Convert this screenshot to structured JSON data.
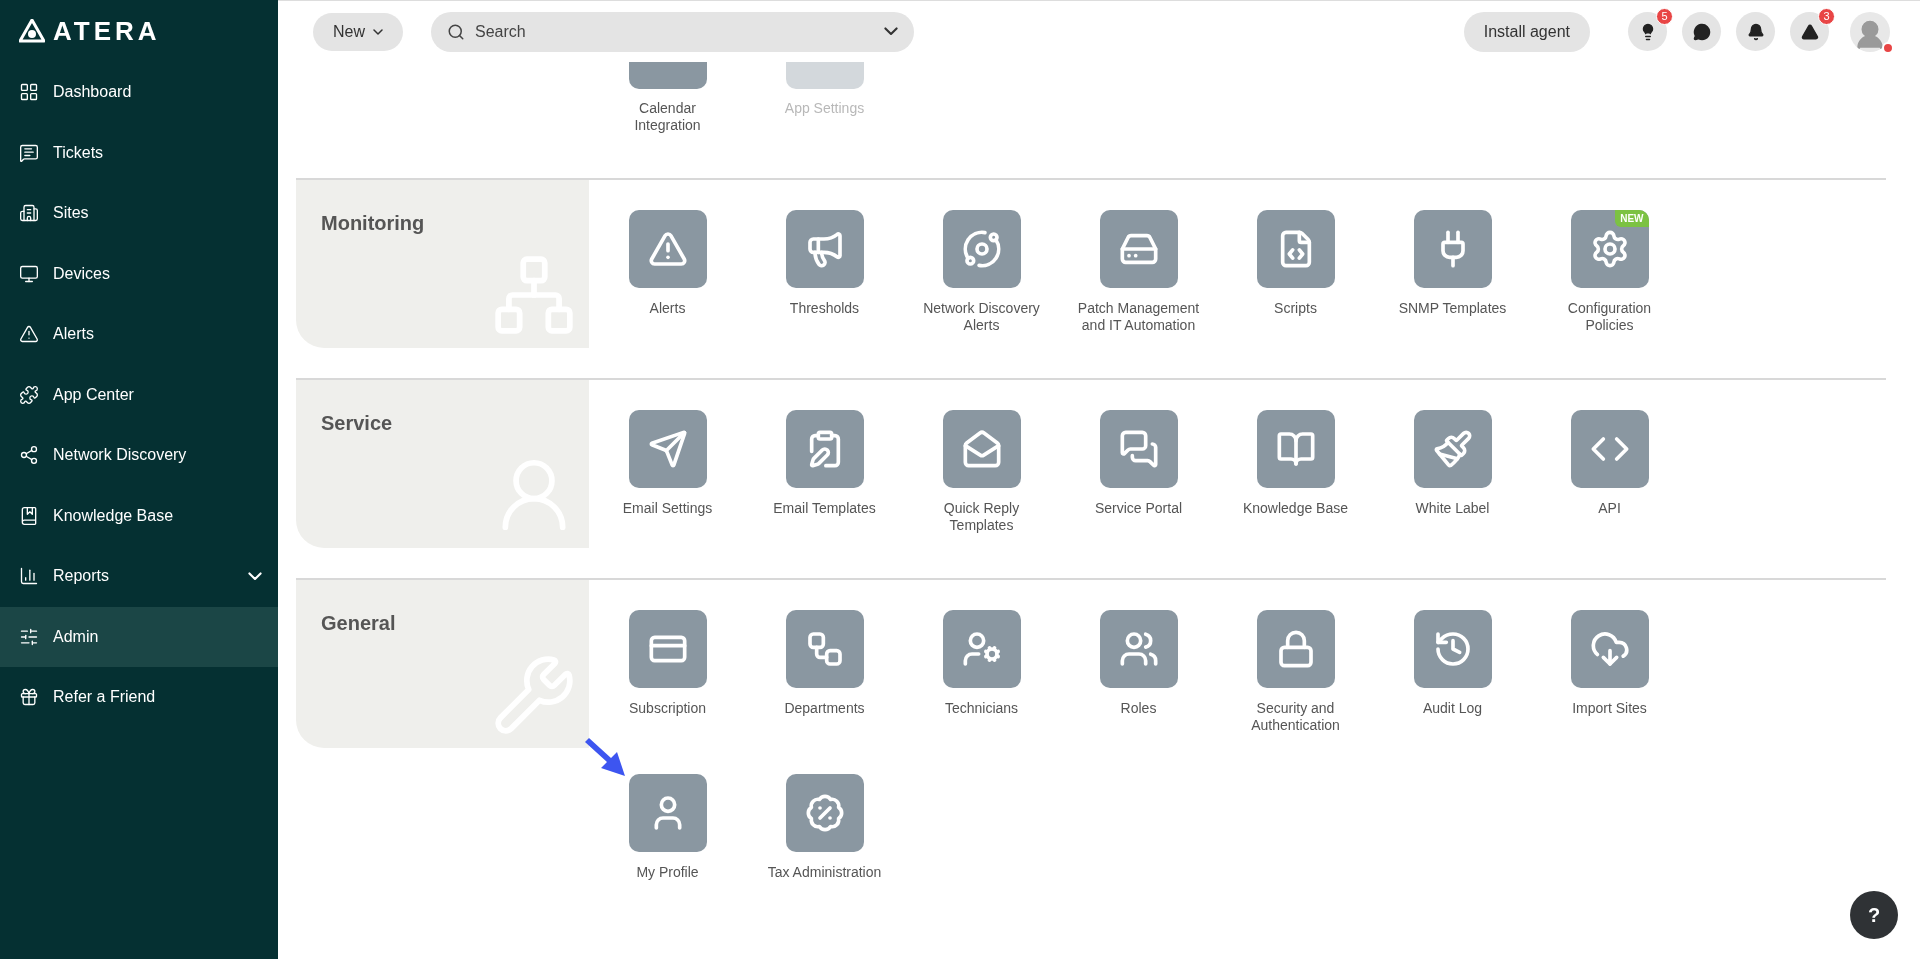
{
  "brand": "ATERA",
  "sidebar": {
    "items": [
      {
        "label": "Dashboard",
        "selected": false,
        "submenu": false
      },
      {
        "label": "Tickets",
        "selected": false,
        "submenu": false
      },
      {
        "label": "Sites",
        "selected": false,
        "submenu": false
      },
      {
        "label": "Devices",
        "selected": false,
        "submenu": false
      },
      {
        "label": "Alerts",
        "selected": false,
        "submenu": false
      },
      {
        "label": "App Center",
        "selected": false,
        "submenu": false
      },
      {
        "label": "Network Discovery",
        "selected": false,
        "submenu": false
      },
      {
        "label": "Knowledge Base",
        "selected": false,
        "submenu": false
      },
      {
        "label": "Reports",
        "selected": false,
        "submenu": true
      },
      {
        "label": "Admin",
        "selected": true,
        "submenu": false
      },
      {
        "label": "Refer a Friend",
        "selected": false,
        "submenu": false
      }
    ]
  },
  "header": {
    "new_button": "New",
    "search": {
      "placeholder": "Search"
    },
    "install_button": "Install agent",
    "hint_badge": "5",
    "alert_badge": "3"
  },
  "top_items": [
    {
      "label": "Calendar Integration",
      "disabled": false
    },
    {
      "label": "App Settings",
      "disabled": true
    }
  ],
  "sections": [
    {
      "title": "Monitoring",
      "items": [
        {
          "label": "Alerts",
          "disabled": false
        },
        {
          "label": "Thresholds",
          "disabled": false
        },
        {
          "label": "Network Discovery Alerts",
          "disabled": false
        },
        {
          "label": "Patch Management and IT Automation",
          "disabled": false
        },
        {
          "label": "Scripts",
          "disabled": false
        },
        {
          "label": "SNMP Templates",
          "disabled": false
        },
        {
          "label": "Configuration Policies",
          "disabled": false,
          "badge": "NEW"
        }
      ]
    },
    {
      "title": "Service",
      "items": [
        {
          "label": "Email Settings",
          "disabled": false
        },
        {
          "label": "Email Templates",
          "disabled": false
        },
        {
          "label": "Quick Reply Templates",
          "disabled": false
        },
        {
          "label": "Service Portal",
          "disabled": false
        },
        {
          "label": "Knowledge Base",
          "disabled": false
        },
        {
          "label": "White Label",
          "disabled": false
        },
        {
          "label": "API",
          "disabled": false
        }
      ]
    },
    {
      "title": "General",
      "items": [
        {
          "label": "Subscription",
          "disabled": false
        },
        {
          "label": "Departments",
          "disabled": false
        },
        {
          "label": "Technicians",
          "disabled": false
        },
        {
          "label": "Roles",
          "disabled": false
        },
        {
          "label": "Security and Authentication",
          "disabled": false
        },
        {
          "label": "Audit Log",
          "disabled": false
        },
        {
          "label": "Import Sites",
          "disabled": false
        },
        {
          "label": "My Profile",
          "disabled": false,
          "pointer": true
        },
        {
          "label": "Tax Administration",
          "disabled": false
        }
      ]
    }
  ],
  "help_button": "?"
}
